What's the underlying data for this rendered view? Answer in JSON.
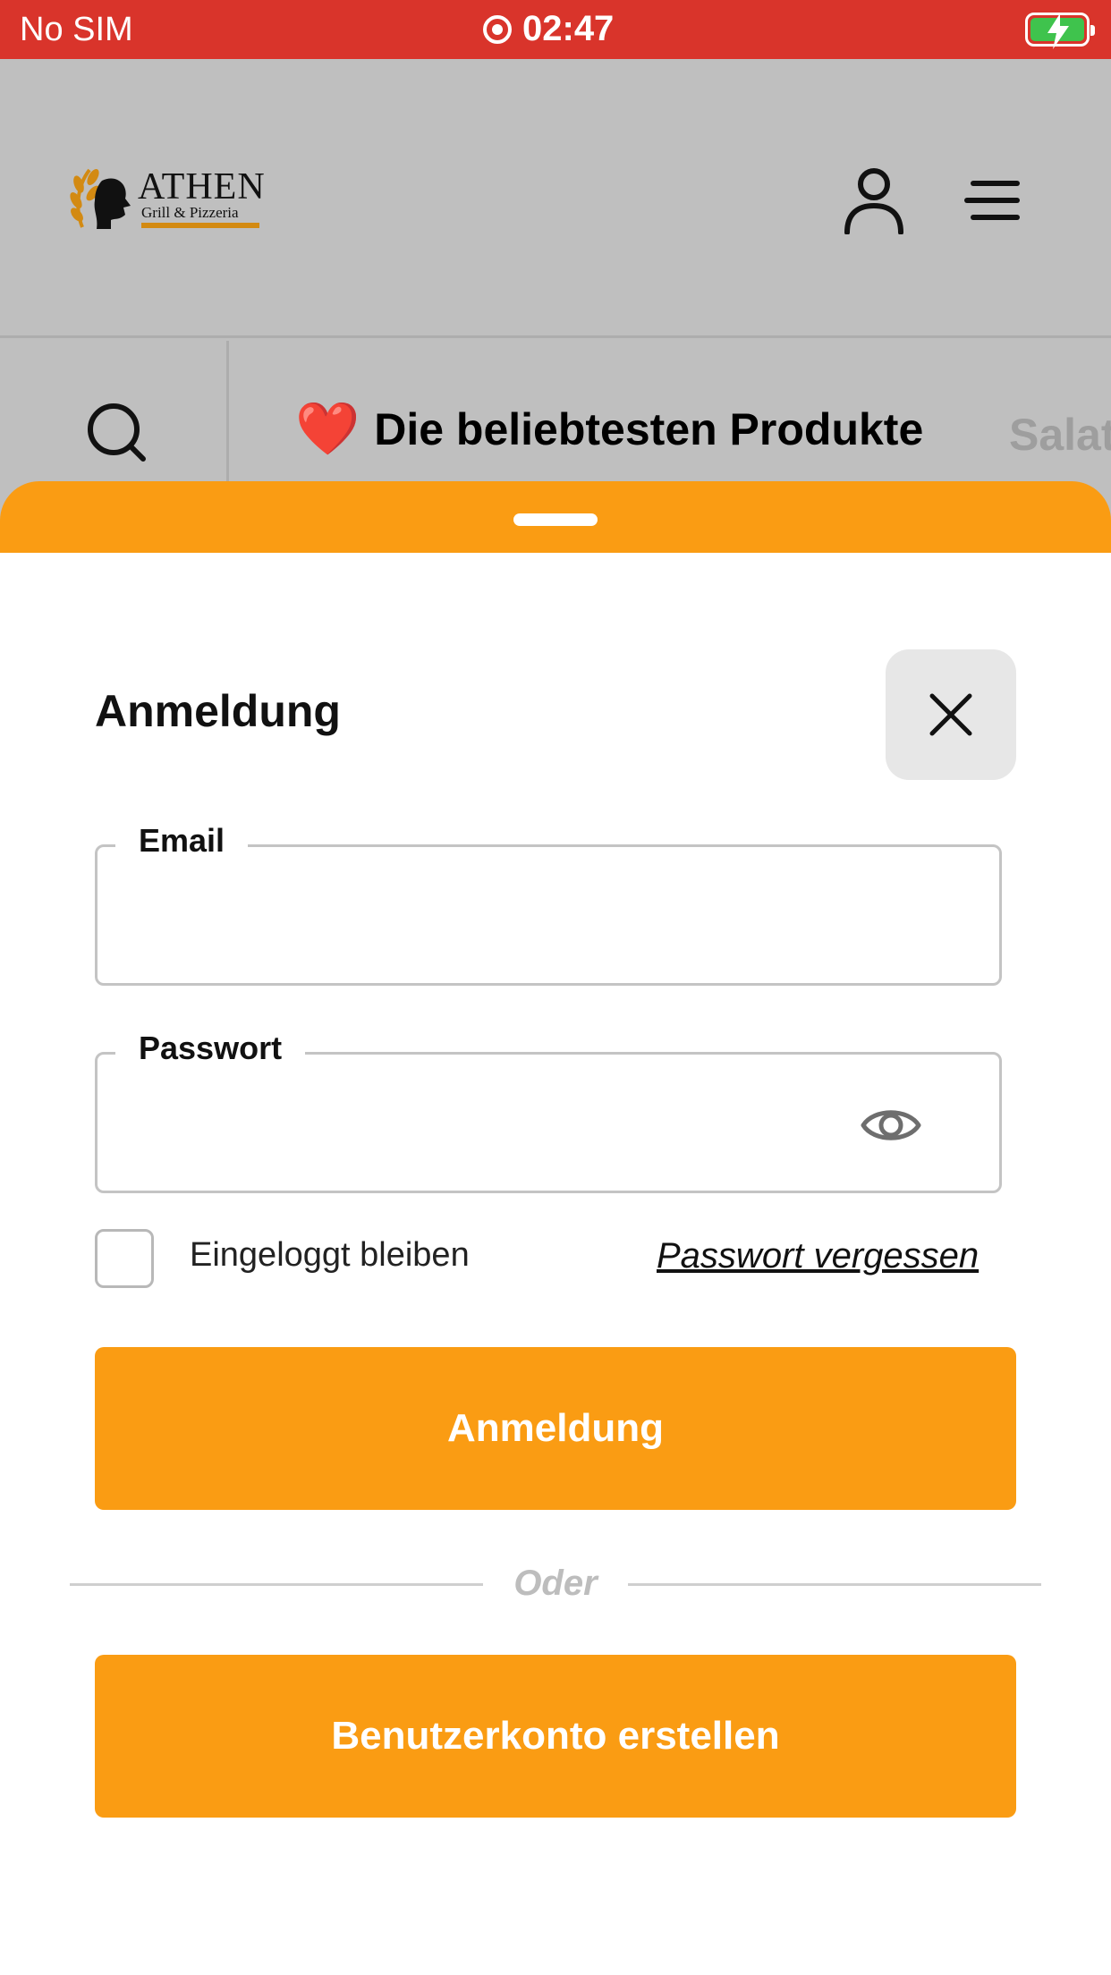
{
  "status_bar": {
    "carrier": "No SIM",
    "time": "02:47",
    "battery_color": "#3fc34d"
  },
  "header": {
    "logo_name": "ATHEN",
    "logo_sub": "Grill & Pizzeria",
    "user_icon": "user-icon",
    "menu_icon": "menu-icon"
  },
  "categories": {
    "search_icon": "search-icon",
    "active_label": "Die beliebtesten Produkte",
    "active_emoji": "❤️",
    "next_label": "Salat"
  },
  "login": {
    "title": "Anmeldung",
    "close_icon": "close-icon",
    "email_label": "Email",
    "email_value": "",
    "password_label": "Passwort",
    "password_value": "",
    "password_toggle_icon": "eye-icon",
    "remember_label": "Eingeloggt bleiben",
    "remember_checked": false,
    "forgot_label": "Passwort vergessen",
    "login_button": "Anmeldung",
    "divider_label": "Oder",
    "create_account_button": "Benutzerkonto erstellen"
  },
  "colors": {
    "accent": "#fa9c13",
    "status_bar": "#d9342b",
    "overlay": "#bfbfbf"
  }
}
